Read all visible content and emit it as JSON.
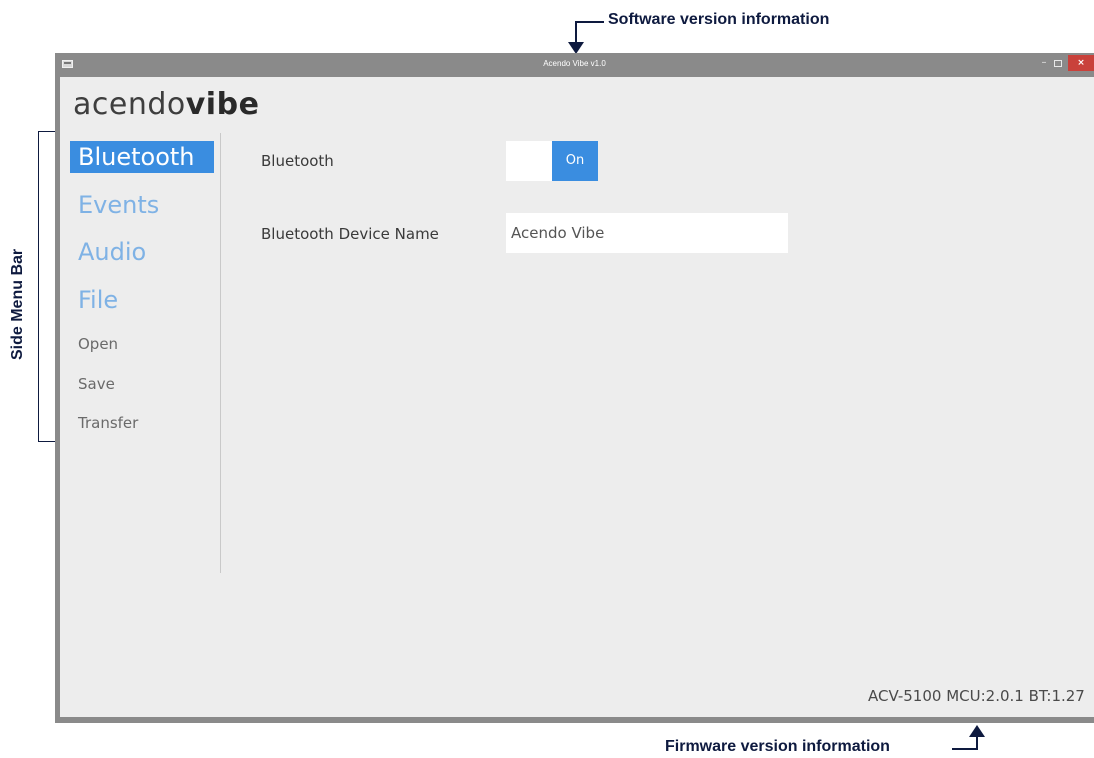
{
  "window": {
    "title": "Acendo Vibe v1.0",
    "controls": {
      "minimize": "–",
      "close": "×"
    },
    "colors": {
      "accent": "#3a8de0",
      "menu_inactive": "#7fb2e5",
      "titlebar": "#8a8a8a",
      "close": "#c9413b"
    }
  },
  "logo": {
    "prefix": "acendo",
    "suffix": "vibe"
  },
  "sidebar": {
    "items": [
      {
        "label": "Bluetooth",
        "active": true
      },
      {
        "label": "Events",
        "active": false
      },
      {
        "label": "Audio",
        "active": false
      },
      {
        "label": "File",
        "active": false
      }
    ],
    "file_actions": [
      {
        "label": "Open"
      },
      {
        "label": "Save"
      },
      {
        "label": "Transfer"
      }
    ]
  },
  "main": {
    "bluetooth_label": "Bluetooth",
    "bluetooth_toggle": {
      "state_label": "On",
      "on": true
    },
    "device_name_label": "Bluetooth Device Name",
    "device_name_value": "Acendo Vibe"
  },
  "footer": {
    "firmware": "ACV-5100 MCU:2.0.1  BT:1.27"
  },
  "annotations": {
    "software": "Software version information",
    "firmware": "Firmware version information",
    "side_menu": "Side Menu Bar"
  }
}
